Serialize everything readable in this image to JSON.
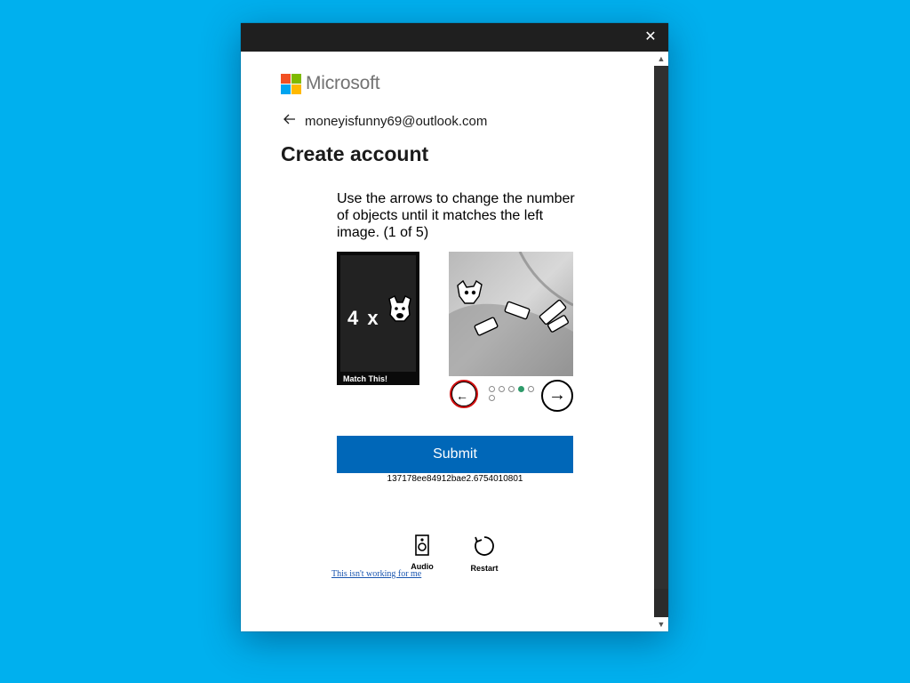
{
  "window": {
    "close_icon": "close-icon"
  },
  "brand": {
    "name": "Microsoft",
    "colors": [
      "#f25022",
      "#7fba00",
      "#00a4ef",
      "#ffb900"
    ]
  },
  "account": {
    "back_icon": "arrow-left-icon",
    "email": "moneyisfunny69@outlook.com"
  },
  "page": {
    "heading": "Create account"
  },
  "captcha": {
    "instructions": "Use the arrows to change the number of objects until it matches the left image. (1 of 5)",
    "target_text": "4 x",
    "target_label": "Match This!",
    "prev_icon": "arrow-left-circle-icon",
    "next_icon": "arrow-right-circle-icon",
    "dots_total": 6,
    "dots_active_index": 3,
    "accent_color": "#2e9b6a"
  },
  "actions": {
    "submit_label": "Submit",
    "session_id": "137178ee84912bae2.6754010801",
    "audio_label": "Audio",
    "restart_label": "Restart",
    "help_link": "This isn't working for me"
  },
  "colors": {
    "desktop": "#00b0ee",
    "submit_bg": "#0067b8"
  }
}
